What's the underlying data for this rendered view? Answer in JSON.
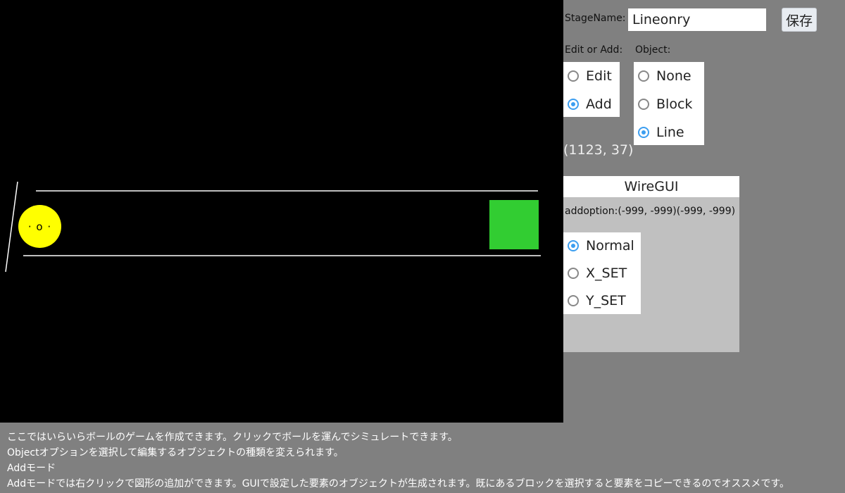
{
  "canvas": {
    "background": "#000000",
    "ball_face": "· o ·",
    "ball_color": "#ffff00",
    "goal_color": "#32cd32"
  },
  "toolbar": {
    "stage_name_label": "StageName:",
    "stage_name_value": "Lineonry",
    "save_label": "保存"
  },
  "edit_or_add": {
    "label": "Edit or Add:",
    "options": [
      {
        "label": "Edit",
        "selected": false
      },
      {
        "label": "Add",
        "selected": true
      }
    ]
  },
  "object": {
    "label": "Object:",
    "options": [
      {
        "label": "None",
        "selected": false
      },
      {
        "label": "Block",
        "selected": false
      },
      {
        "label": "Line",
        "selected": true
      }
    ]
  },
  "cursor_coords": "(1123, 37)",
  "wire_gui": {
    "title": "WireGUI",
    "addoption": "addoption:(-999, -999)(-999, -999)",
    "options": [
      {
        "label": "Normal",
        "selected": true
      },
      {
        "label": "X_SET",
        "selected": false
      },
      {
        "label": "Y_SET",
        "selected": false
      }
    ]
  },
  "help_lines": [
    "ここではいらいらボールのゲームを作成できます。クリックでボールを運んでシミュレートできます。",
    "Objectオプションを選択して編集するオブジェクトの種類を変えられます。",
    "Addモード",
    "Addモードでは右クリックで図形の追加ができます。GUIで設定した要素のオブジェクトが生成されます。既にあるブロックを選択すると要素をコピーできるのでオススメです。"
  ]
}
